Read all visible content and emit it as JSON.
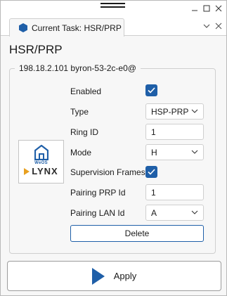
{
  "window": {
    "tab_title": "Current Task: HSR/PRP"
  },
  "page": {
    "title": "HSR/PRP"
  },
  "group": {
    "legend": "198.18.2.101 byron-53-2c-e0@"
  },
  "logo": {
    "brand_small": "WeOS",
    "brand_name": "LYNX"
  },
  "form": {
    "enabled": {
      "label": "Enabled",
      "checked": true
    },
    "type": {
      "label": "Type",
      "value": "HSP-PRP"
    },
    "ring_id": {
      "label": "Ring ID",
      "value": "1"
    },
    "mode": {
      "label": "Mode",
      "value": "H"
    },
    "supervision_frames": {
      "label": "Supervision Frames",
      "checked": true
    },
    "pairing_prp_id": {
      "label": "Pairing PRP Id",
      "value": "1"
    },
    "pairing_lan_id": {
      "label": "Pairing LAN Id",
      "value": "A"
    },
    "delete_label": "Delete"
  },
  "footer": {
    "apply_label": "Apply"
  },
  "colors": {
    "accent": "#1f5fa8",
    "lynx_arrow": "#e8a020"
  }
}
